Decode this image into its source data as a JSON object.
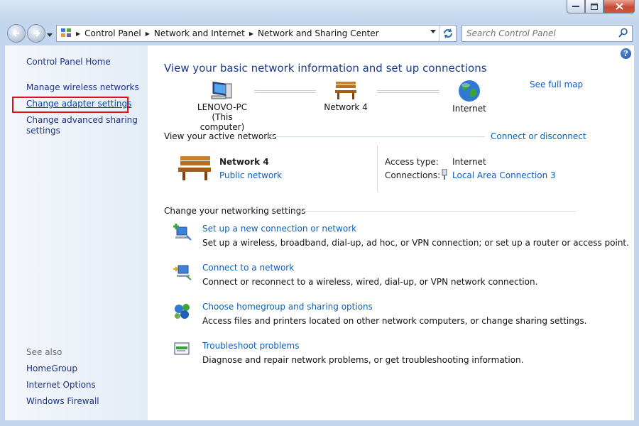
{
  "address": {
    "crumbs": [
      "Control Panel",
      "Network and Internet",
      "Network and Sharing Center"
    ]
  },
  "search": {
    "placeholder": "Search Control Panel"
  },
  "sidebar": {
    "home": "Control Panel Home",
    "links": [
      "Manage wireless networks",
      "Change adapter settings",
      "Change advanced sharing settings"
    ],
    "see_also_heading": "See also",
    "see_also": [
      "HomeGroup",
      "Internet Options",
      "Windows Firewall"
    ]
  },
  "main": {
    "title": "View your basic network information and set up connections",
    "see_full_map": "See full map",
    "map": {
      "computer_name": "LENOVO-PC",
      "computer_sub": "(This computer)",
      "network": "Network  4",
      "internet": "Internet"
    },
    "active": {
      "heading": "View your active networks",
      "connect_link": "Connect or disconnect",
      "network_name": "Network  4",
      "network_type": "Public network",
      "access_label": "Access type:",
      "access_value": "Internet",
      "connections_label": "Connections:",
      "connection_value": "Local Area Connection 3"
    },
    "settings": {
      "heading": "Change your networking settings",
      "tasks": [
        {
          "title": "Set up a new connection or network",
          "desc": "Set up a wireless, broadband, dial-up, ad hoc, or VPN connection; or set up a router or access point.",
          "icon": "new-connection-icon"
        },
        {
          "title": "Connect to a network",
          "desc": "Connect or reconnect to a wireless, wired, dial-up, or VPN network connection.",
          "icon": "connect-network-icon"
        },
        {
          "title": "Choose homegroup and sharing options",
          "desc": "Access files and printers located on other network computers, or change sharing settings.",
          "icon": "homegroup-icon"
        },
        {
          "title": "Troubleshoot problems",
          "desc": "Diagnose and repair network problems, or get troubleshooting information.",
          "icon": "troubleshoot-icon"
        }
      ]
    }
  }
}
